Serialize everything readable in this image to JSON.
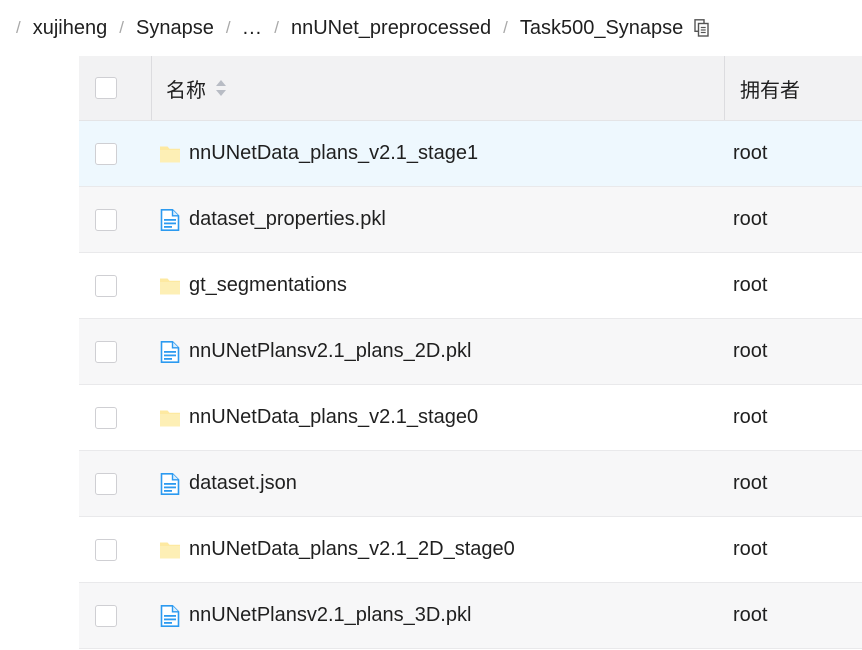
{
  "breadcrumb": {
    "items": [
      "xujiheng",
      "Synapse",
      "...",
      "nnUNet_preprocessed",
      "Task500_Synapse"
    ],
    "separator": "/"
  },
  "table": {
    "headers": {
      "name": "名称",
      "owner": "拥有者"
    },
    "rows": [
      {
        "name": "nnUNetData_plans_v2.1_stage1",
        "owner": "root",
        "type": "folder-icon"
      },
      {
        "name": "dataset_properties.pkl",
        "owner": "root",
        "type": "file-icon"
      },
      {
        "name": "gt_segmentations",
        "owner": "root",
        "type": "folder-icon"
      },
      {
        "name": "nnUNetPlansv2.1_plans_2D.pkl",
        "owner": "root",
        "type": "file-icon"
      },
      {
        "name": "nnUNetData_plans_v2.1_stage0",
        "owner": "root",
        "type": "folder-icon"
      },
      {
        "name": "dataset.json",
        "owner": "root",
        "type": "file-icon"
      },
      {
        "name": "nnUNetData_plans_v2.1_2D_stage0",
        "owner": "root",
        "type": "folder-icon"
      },
      {
        "name": "nnUNetPlansv2.1_plans_3D.pkl",
        "owner": "root",
        "type": "file-icon"
      }
    ]
  },
  "colors": {
    "folder": "#fde9a1",
    "file": "#2c9af0",
    "highlight_row": "#eef8fe",
    "header_bg": "#f2f2f3"
  }
}
